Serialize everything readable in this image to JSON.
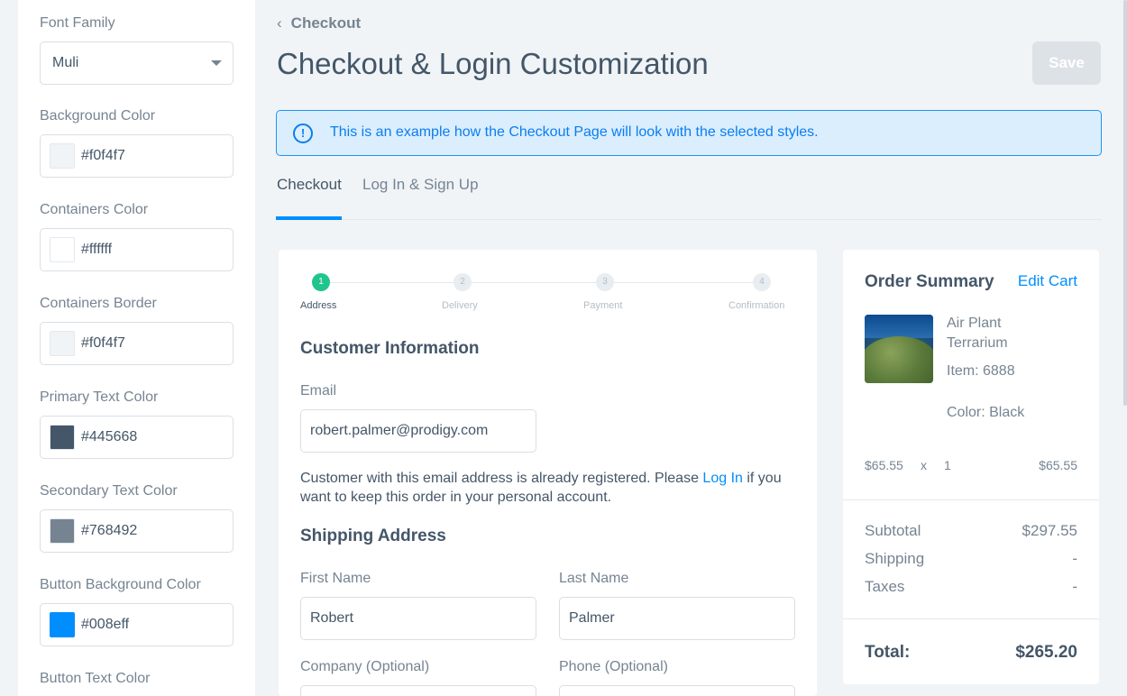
{
  "settings": {
    "font_family": {
      "label": "Font Family",
      "value": "Muli"
    },
    "fields": [
      {
        "label": "Background Color",
        "hex": "#f0f4f7",
        "swatch": "#f0f4f7"
      },
      {
        "label": "Containers Color",
        "hex": "#ffffff",
        "swatch": "#ffffff"
      },
      {
        "label": "Containers Border",
        "hex": "#f0f4f7",
        "swatch": "#f0f4f7"
      },
      {
        "label": "Primary Text Color",
        "hex": "#445668",
        "swatch": "#445668"
      },
      {
        "label": "Secondary Text Color",
        "hex": "#768492",
        "swatch": "#768492"
      },
      {
        "label": "Button Background Color",
        "hex": "#008eff",
        "swatch": "#008eff"
      },
      {
        "label": "Button Text Color"
      }
    ]
  },
  "header": {
    "back_label": "Checkout",
    "title": "Checkout & Login Customization",
    "save_label": "Save"
  },
  "banner": {
    "icon": "info-icon",
    "text": "This is an example how the Checkout Page will look with the selected styles."
  },
  "tabs": [
    {
      "label": "Checkout",
      "active": true
    },
    {
      "label": "Log In & Sign Up",
      "active": false
    }
  ],
  "steps": [
    {
      "num": "1",
      "label": "Address"
    },
    {
      "num": "2",
      "label": "Delivery"
    },
    {
      "num": "3",
      "label": "Payment"
    },
    {
      "num": "4",
      "label": "Confirmation"
    }
  ],
  "checkout": {
    "customer_heading": "Customer Information",
    "email_label": "Email",
    "email_value": "robert.palmer@prodigy.com",
    "note_before": "Customer with this email address is already registered. Please ",
    "note_link": "Log In",
    "note_after": " if you want to keep this order in your personal account.",
    "shipping_heading": "Shipping Address",
    "first_name_label": "First Name",
    "first_name_value": "Robert",
    "last_name_label": "Last Name",
    "last_name_value": "Palmer",
    "company_label": "Company (Optional)",
    "phone_label": "Phone (Optional)"
  },
  "summary": {
    "heading": "Order Summary",
    "edit_cart": "Edit Cart",
    "product_name_line1": "Air Plant",
    "product_name_line2": "Terrarium",
    "item": "Item: 6888",
    "color": "Color: Black",
    "unit_price": "$65.55",
    "times": "x",
    "qty": "1",
    "line_total": "$65.55",
    "subtotal_label": "Subtotal",
    "subtotal_value": "$297.55",
    "shipping_label": "Shipping",
    "shipping_value": "-",
    "taxes_label": "Taxes",
    "taxes_value": "-",
    "total_label": "Total:",
    "total_value": "$265.20"
  },
  "colors": {
    "accent": "#008eff",
    "success": "#1fc58d",
    "primary_text": "#445668",
    "secondary_text": "#768492"
  }
}
